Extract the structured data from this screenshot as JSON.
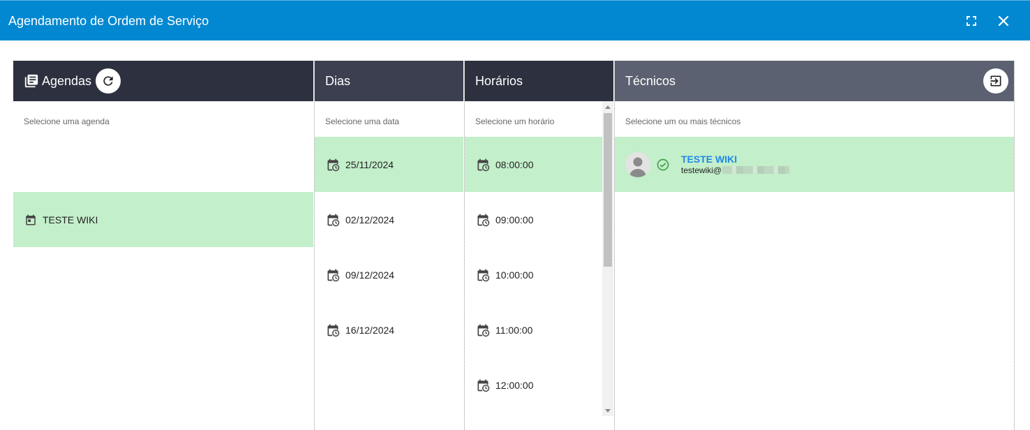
{
  "window": {
    "title": "Agendamento de Ordem de Serviço"
  },
  "panels": {
    "agendas": {
      "title": "Agendas",
      "hint": "Selecione uma agenda",
      "items": [
        {
          "label": "TESTE WIKI",
          "selected": true
        }
      ]
    },
    "dias": {
      "title": "Dias",
      "hint": "Selecione uma data",
      "items": [
        {
          "label": "25/11/2024",
          "selected": true
        },
        {
          "label": "02/12/2024",
          "selected": false
        },
        {
          "label": "09/12/2024",
          "selected": false
        },
        {
          "label": "16/12/2024",
          "selected": false
        }
      ]
    },
    "horarios": {
      "title": "Horários",
      "hint": "Selecione um horário",
      "items": [
        {
          "label": "08:00:00",
          "selected": true
        },
        {
          "label": "09:00:00",
          "selected": false
        },
        {
          "label": "10:00:00",
          "selected": false
        },
        {
          "label": "11:00:00",
          "selected": false
        },
        {
          "label": "12:00:00",
          "selected": false
        }
      ]
    },
    "tecnicos": {
      "title": "Técnicos",
      "hint": "Selecione um ou mais técnicos",
      "items": [
        {
          "name": "TESTE WIKI",
          "email": "testewiki@",
          "selected": true
        }
      ]
    }
  },
  "colors": {
    "titlebar": "#0288d1",
    "selected_row": "#c3efcb",
    "tech_name": "#1e88e5",
    "check": "#43a047"
  },
  "icons": {
    "fullscreen": "fullscreen-icon",
    "close": "close-icon",
    "agendas": "library-books-icon",
    "refresh": "refresh-icon",
    "exit": "exit-to-app-icon",
    "calendar": "calendar-icon",
    "calendar_clock": "calendar-clock-icon",
    "avatar": "account-icon",
    "check": "check-circle-icon"
  }
}
